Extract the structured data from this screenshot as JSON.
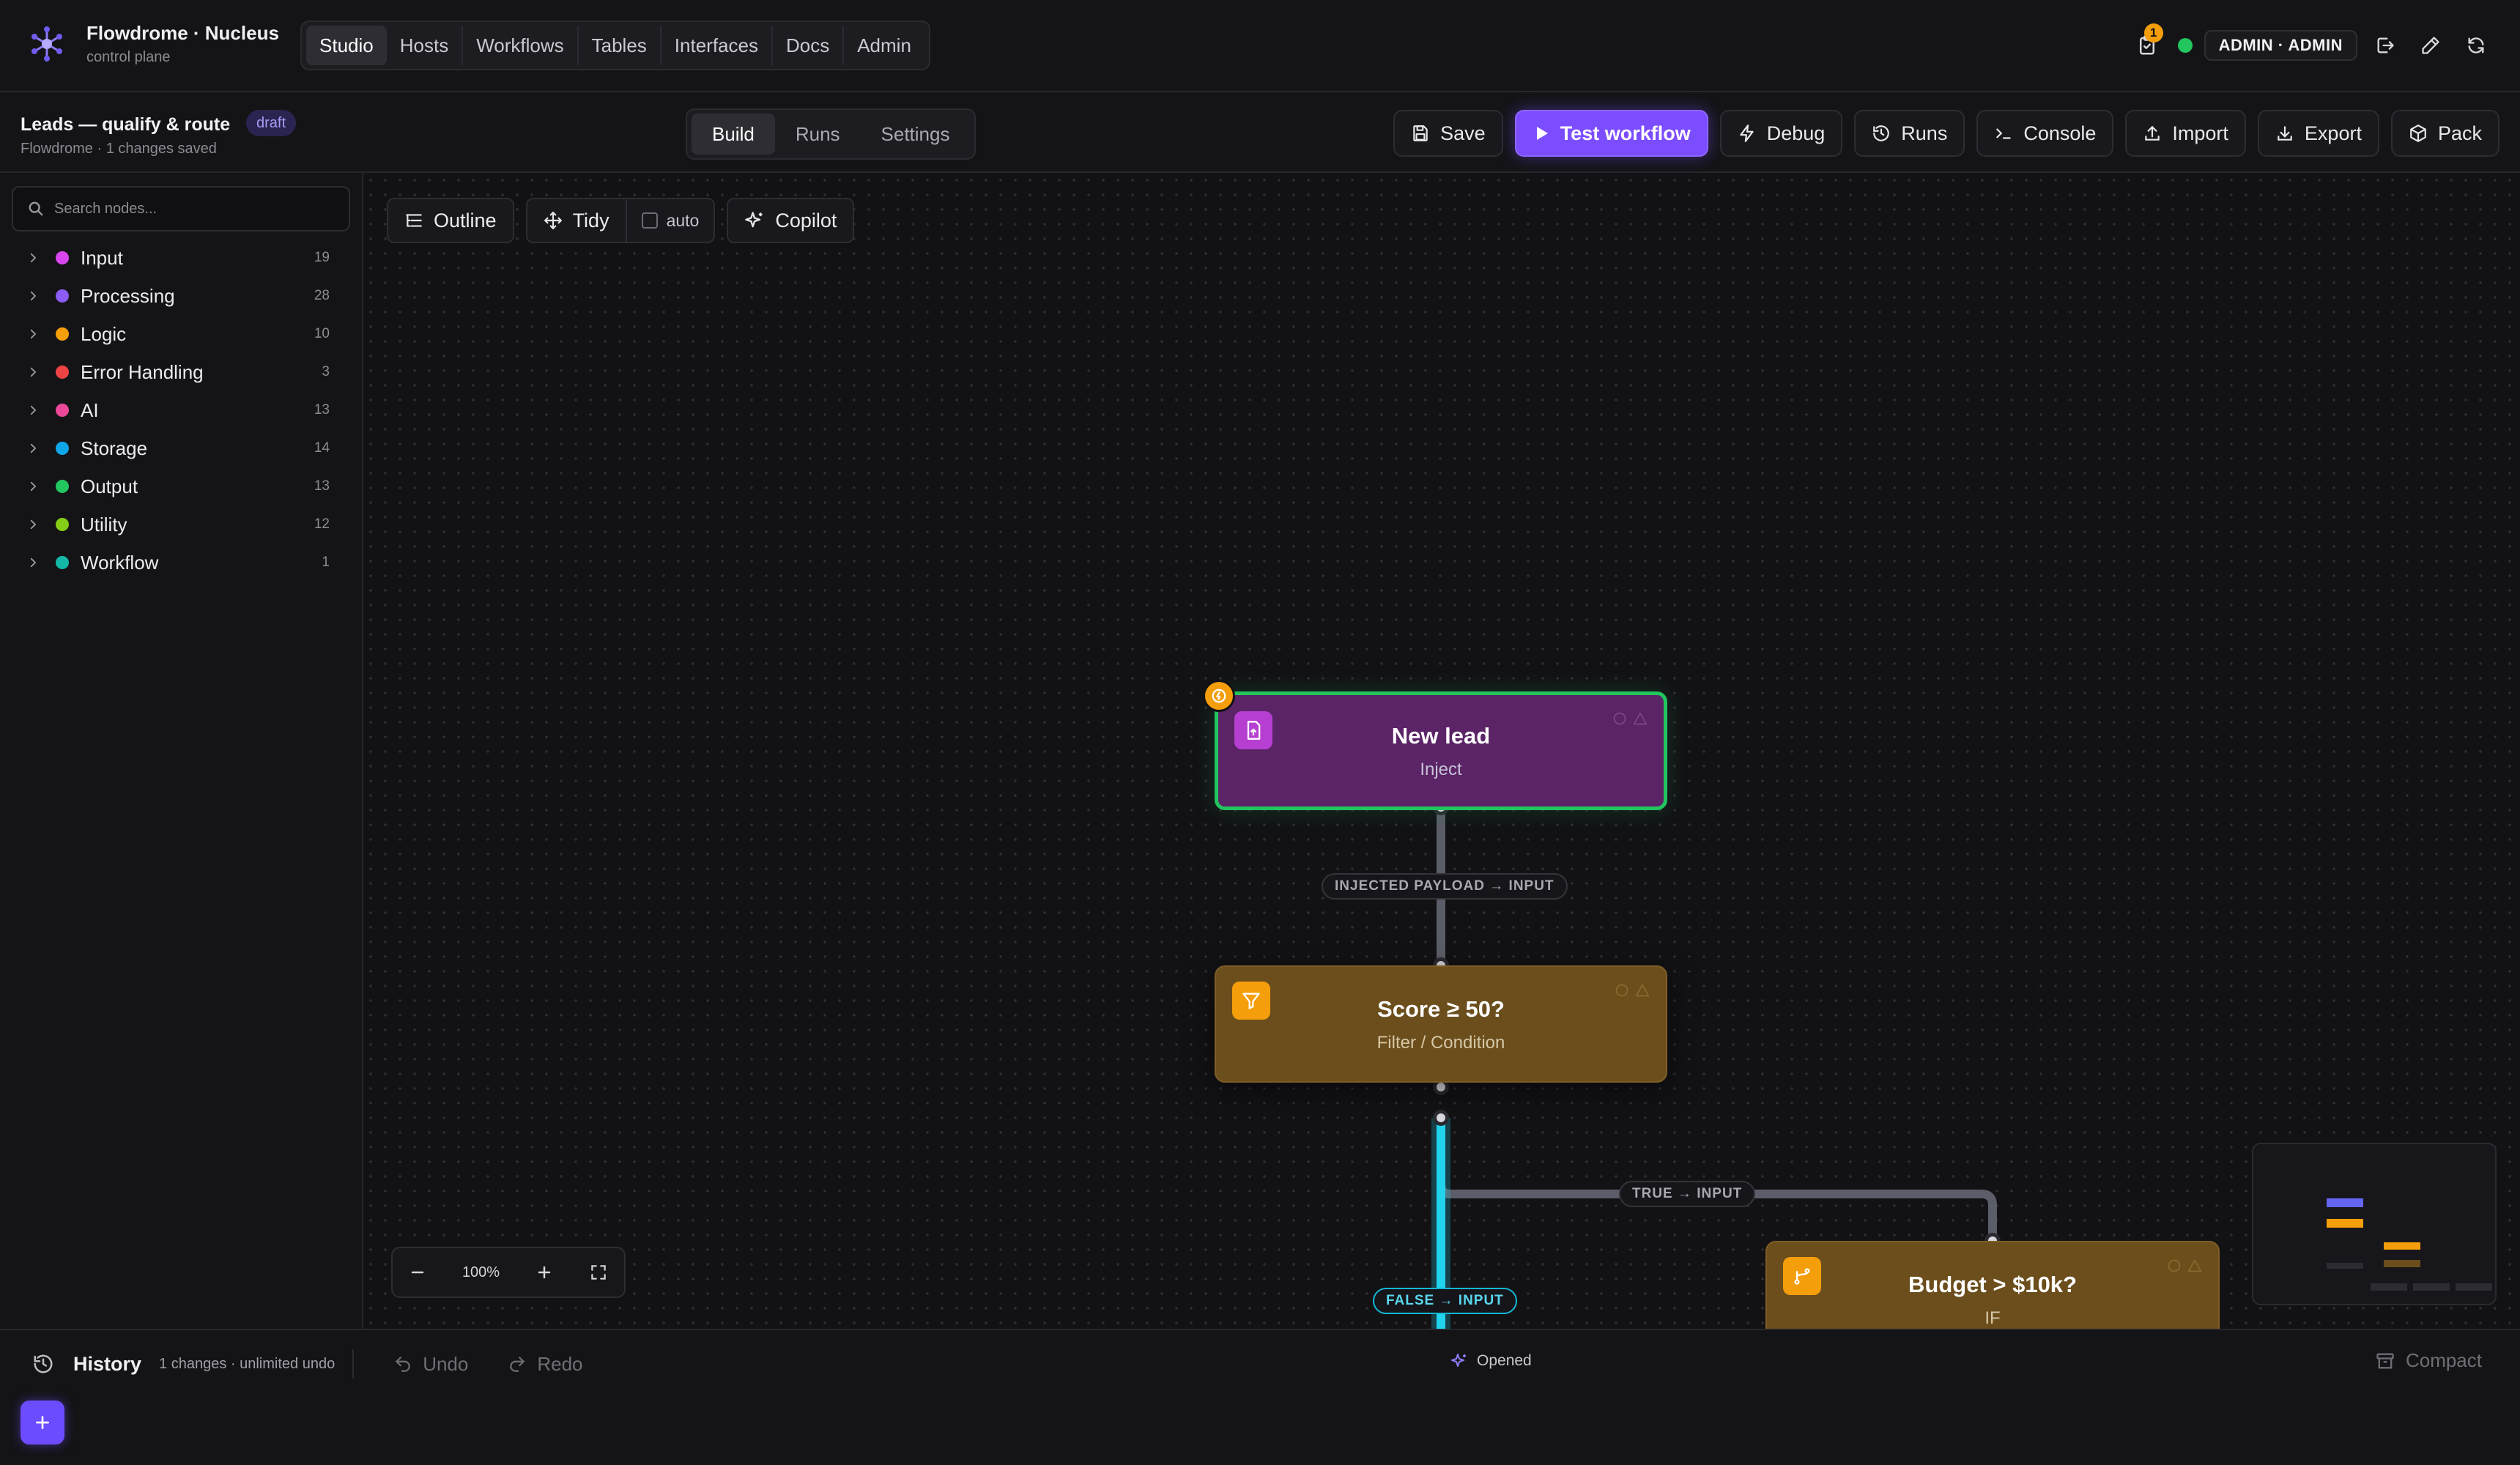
{
  "brand": {
    "name": "Flowdrome · Nucleus",
    "subtitle": "control plane"
  },
  "topnav": [
    "Studio",
    "Hosts",
    "Workflows",
    "Tables",
    "Interfaces",
    "Docs",
    "Admin"
  ],
  "topnav_active": "Studio",
  "header_right": {
    "notification_count": "1",
    "status_color": "#22c55e",
    "user": "ADMIN · ADMIN",
    "icons": [
      "clipboard-check-icon",
      "logout-icon",
      "pencil-icon",
      "refresh-icon"
    ]
  },
  "workflow": {
    "title": "Leads — qualify & route",
    "badge": "draft",
    "subtitle": "Flowdrome · 1 changes saved"
  },
  "mode_tabs": [
    "Build",
    "Runs",
    "Settings"
  ],
  "mode_active": "Build",
  "actions": {
    "save": "Save",
    "test": "Test workflow",
    "debug": "Debug",
    "runs": "Runs",
    "console": "Console",
    "import": "Import",
    "export": "Export",
    "pack": "Pack"
  },
  "colors": {
    "accent": "#7c4dff",
    "trigger_border": "#22c55e",
    "active_edge": "#14b8d4"
  },
  "sidebar": {
    "search_placeholder": "Search nodes...",
    "categories": [
      {
        "name": "Input",
        "count": "19",
        "color": "#d946ef"
      },
      {
        "name": "Processing",
        "count": "28",
        "color": "#8b5cf6"
      },
      {
        "name": "Logic",
        "count": "10",
        "color": "#f59e0b"
      },
      {
        "name": "Error Handling",
        "count": "3",
        "color": "#ef4444"
      },
      {
        "name": "AI",
        "count": "13",
        "color": "#ec4899"
      },
      {
        "name": "Storage",
        "count": "14",
        "color": "#0ea5e9"
      },
      {
        "name": "Output",
        "count": "13",
        "color": "#22c55e"
      },
      {
        "name": "Utility",
        "count": "12",
        "color": "#84cc16"
      },
      {
        "name": "Workflow",
        "count": "1",
        "color": "#14b8a6"
      }
    ]
  },
  "toolbar": {
    "outline": "Outline",
    "tidy": "Tidy",
    "auto": "auto",
    "copilot": "Copilot"
  },
  "nodes": {
    "new_lead": {
      "title": "New lead",
      "type": "Inject"
    },
    "score": {
      "title": "Score ≥ 50?",
      "type": "Filter / Condition"
    },
    "budget": {
      "title": "Budget > $10k?",
      "type": "IF"
    }
  },
  "edges": {
    "inject_to_score": "INJECTED PAYLOAD → INPUT",
    "true_branch": "TRUE → INPUT",
    "false_branch": "FALSE → INPUT"
  },
  "zoom": {
    "level": "100%"
  },
  "history": {
    "title": "History",
    "note": "1 changes · unlimited undo",
    "undo": "Undo",
    "redo": "Redo",
    "status": "Opened",
    "compact": "Compact"
  }
}
